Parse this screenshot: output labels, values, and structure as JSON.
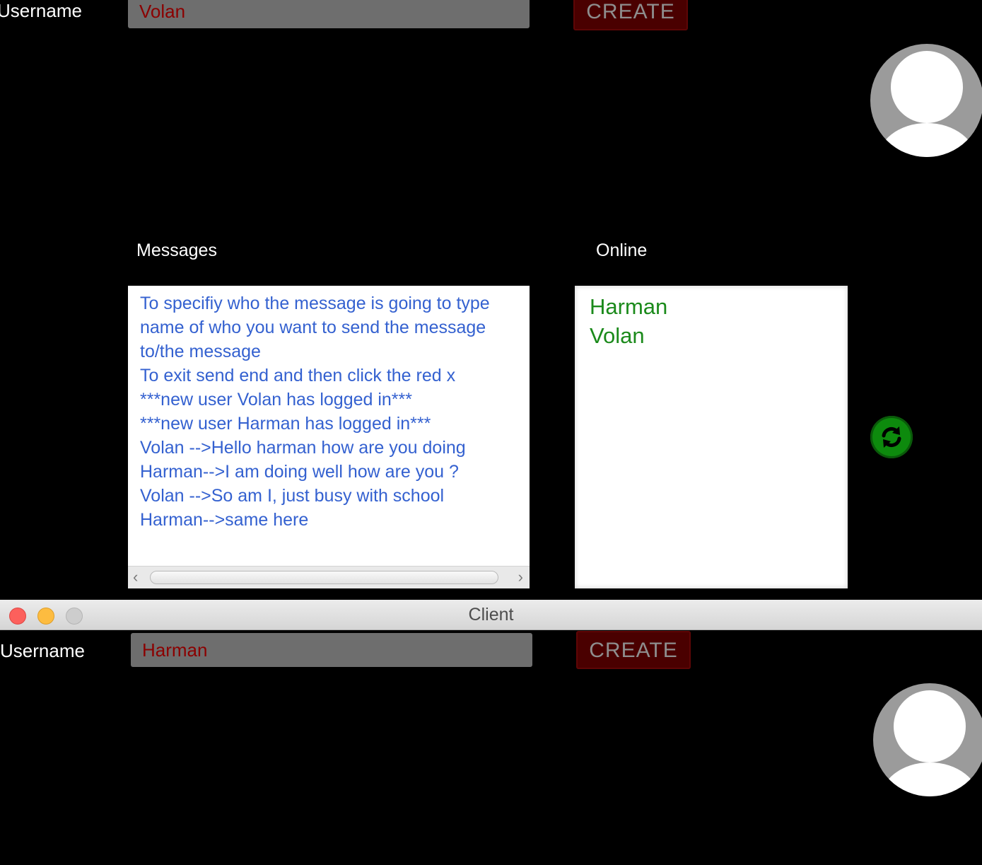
{
  "colors": {
    "background": "#000000",
    "field_background": "#6e6e6e",
    "field_text": "#8b0000",
    "create_button_background": "#4a0000",
    "create_button_text": "#8e8e8e",
    "message_text": "#3461d0",
    "online_user_text": "#1b8a1b",
    "refresh_button": "#0d8a0d"
  },
  "top_window": {
    "username_label": "Username",
    "username_value": "Volan",
    "create_label": "CREATE",
    "avatar_icon": "default-user-avatar",
    "messages_label": "Messages",
    "online_label": "Online",
    "messages": [
      "To specifiy who the message is going to type",
      "name of who you want to send the message",
      "to/the message",
      "To exit send end and then click the red x",
      "***new user Volan  has logged in***",
      "***new user Harman has logged in***",
      "Volan -->Hello harman how are you doing",
      "Harman-->I am doing well how are you ?",
      "Volan -->So am I, just busy with school",
      "Harman-->same here"
    ],
    "online_users": [
      "Harman",
      "Volan"
    ],
    "refresh_icon": "refresh-icon",
    "scroll_left_glyph": "‹",
    "scroll_right_glyph": "›"
  },
  "bottom_window": {
    "title": "Client",
    "username_label": "Username",
    "username_value": "Harman",
    "create_label": "CREATE",
    "avatar_icon": "default-user-avatar"
  }
}
